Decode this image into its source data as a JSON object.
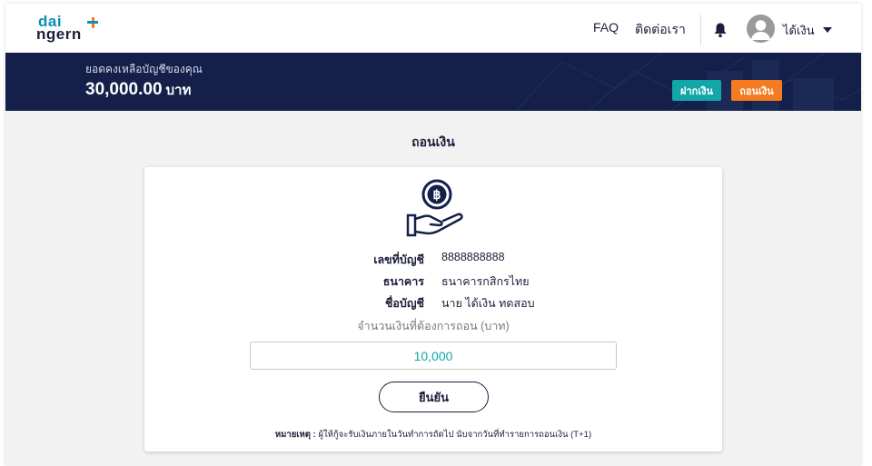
{
  "header": {
    "logo_line1": "dai",
    "logo_line2": "ngern",
    "nav": {
      "faq": "FAQ",
      "contact": "ติดต่อเรา"
    },
    "user_name": "ได้เงิน"
  },
  "banner": {
    "balance_label": "ยอดคงเหลือบัญชีของคุณ",
    "balance_amount": "30,000.00",
    "balance_unit": "บาท",
    "deposit_label": "ฝากเงิน",
    "withdraw_label": "ถอนเงิน"
  },
  "page": {
    "title": "ถอนเงิน"
  },
  "withdraw": {
    "account_number_label": "เลขที่บัญชี",
    "account_number": "8888888888",
    "bank_label": "ธนาคาร",
    "bank": "ธนาคารกสิกรไทย",
    "account_name_label": "ชื่อบัญชี",
    "account_name": "นาย ได้เงิน ทดสอบ",
    "amount_label": "จำนวนเงินที่ต้องการถอน (บาท)",
    "amount_value": "10,000",
    "confirm_label": "ยืนยัน",
    "note_label": "หมายเหตุ :",
    "note_text": "ผู้ให้กู้จะรับเงินภายในวันทำการถัดไป นับจากวันที่ทำรายการถอนเงิน (T+1)"
  },
  "colors": {
    "navy": "#14204a",
    "teal": "#13a6a8",
    "orange": "#f47b20"
  },
  "icons": {
    "notifications": "bell-icon",
    "user": "avatar-icon",
    "menu": "caret-down-icon",
    "withdraw": "hand-coin-baht-icon"
  }
}
